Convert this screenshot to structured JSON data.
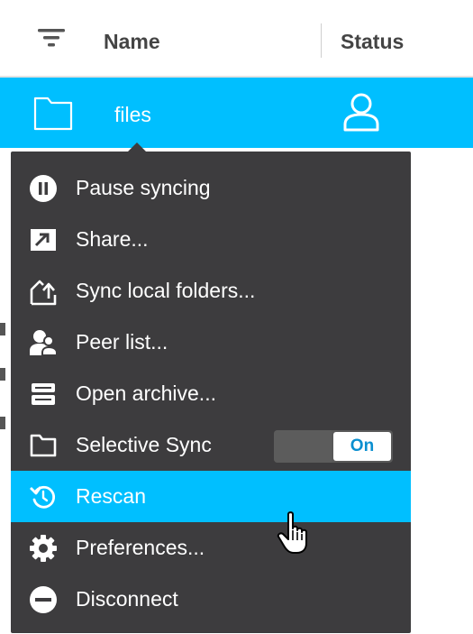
{
  "header": {
    "filter_icon": "filter-icon",
    "name_label": "Name",
    "status_label": "Status"
  },
  "row": {
    "icon": "folder-icon",
    "name": "files",
    "status_icon": "user-icon"
  },
  "menu": {
    "items": [
      {
        "label": "Pause syncing",
        "icon": "pause-icon"
      },
      {
        "label": "Share...",
        "icon": "share-icon"
      },
      {
        "label": "Sync local folders...",
        "icon": "sync-local-folders-icon"
      },
      {
        "label": "Peer list...",
        "icon": "peer-list-icon"
      },
      {
        "label": "Open archive...",
        "icon": "archive-icon"
      },
      {
        "label": "Selective Sync",
        "icon": "folder-icon",
        "toggle": "On"
      },
      {
        "label": "Rescan",
        "icon": "rescan-icon"
      },
      {
        "label": "Preferences...",
        "icon": "gear-icon"
      },
      {
        "label": "Disconnect",
        "icon": "disconnect-icon"
      }
    ]
  },
  "colors": {
    "accent": "#00bfff",
    "menu_bg": "#3d3c3e",
    "toggle_on_text": "#0a8fd0"
  }
}
